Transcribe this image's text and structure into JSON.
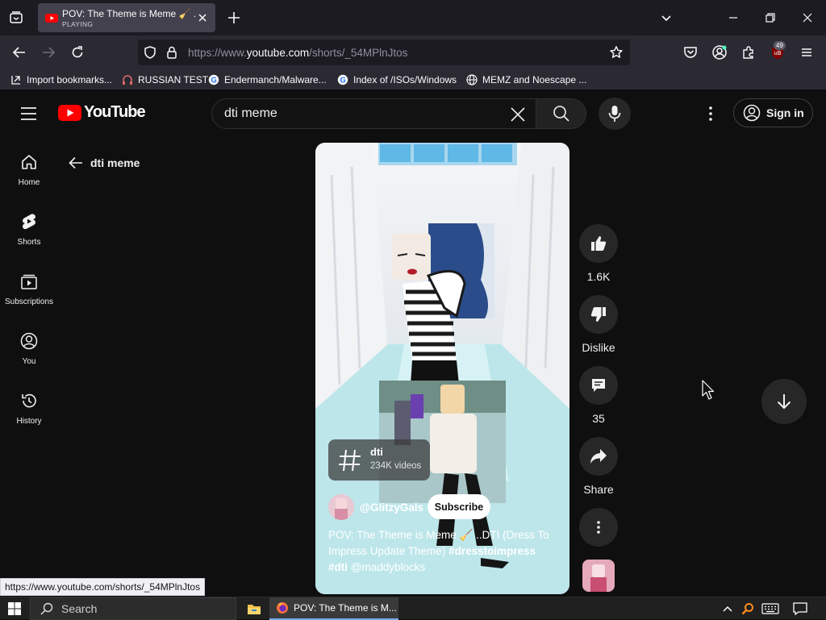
{
  "browser": {
    "tab": {
      "title": "POV: The Theme is Meme 🧹 ..D",
      "status": "PLAYING"
    },
    "url": {
      "prefix": "https://www.",
      "domain": "youtube.com",
      "path": "/shorts/_54MPlnJtos"
    },
    "extension_badge": "49",
    "bookmarks": [
      {
        "label": "Import bookmarks...",
        "icon": "import-icon"
      },
      {
        "label": "RUSSIAN TEST",
        "icon": "headphones-icon"
      },
      {
        "label": "Endermanch/Malware...",
        "icon": "google-icon"
      },
      {
        "label": "Index of /ISOs/Windows",
        "icon": "google-icon"
      },
      {
        "label": "MEMZ and Noescape ...",
        "icon": "globe-icon"
      }
    ],
    "status_url": "https://www.youtube.com/shorts/_54MPlnJtos"
  },
  "youtube": {
    "logo_text": "YouTube",
    "search": {
      "value": "dti meme"
    },
    "sign_in": "Sign in",
    "guide": [
      {
        "label": "Home",
        "icon": "home-icon"
      },
      {
        "label": "Shorts",
        "icon": "shorts-icon"
      },
      {
        "label": "Subscriptions",
        "icon": "subscriptions-icon"
      },
      {
        "label": "You",
        "icon": "you-icon"
      },
      {
        "label": "History",
        "icon": "history-icon"
      }
    ],
    "back_label": "dti meme",
    "short": {
      "hashtag": {
        "name": "dti",
        "count": "234K videos"
      },
      "channel": "@GlitzyGals",
      "subscribe": "Subscribe",
      "caption_text": "POV: The Theme is Meme 🧹 ..DTI (Dress To Impress Update Theme) ",
      "caption_tag1": "#dresstoimpress",
      "caption_tag2": "#dti",
      "caption_mention": " @maddyblocks"
    },
    "actions": {
      "likes": "1.6K",
      "dislike": "Dislike",
      "comments": "35",
      "share": "Share"
    }
  },
  "taskbar": {
    "search": "Search",
    "app_title": "POV: The Theme is M..."
  },
  "colors": {
    "youtube_red": "#ff0000",
    "background": "#0f0f0f",
    "chip": "#272727"
  }
}
